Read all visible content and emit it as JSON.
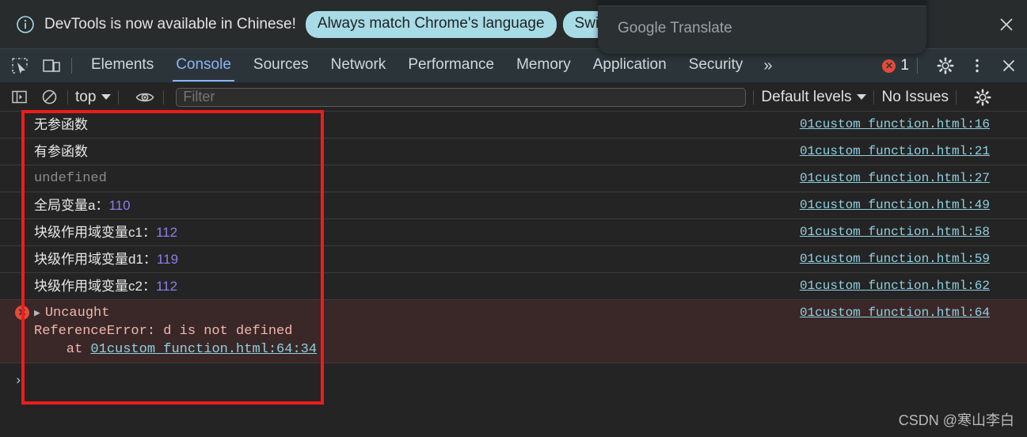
{
  "banner": {
    "info_icon": "info-circle-icon",
    "message": "DevTools is now available in Chinese!",
    "primary_button": "Always match Chrome's language",
    "secondary_button": "Switch D",
    "close_icon": "close-icon"
  },
  "overlay": {
    "popup_title": "Google Translate"
  },
  "tabbar": {
    "inspect_icon": "inspect-element-icon",
    "device_icon": "device-toolbar-icon",
    "tabs": [
      {
        "label": "Elements",
        "active": false
      },
      {
        "label": "Console",
        "active": true
      },
      {
        "label": "Sources",
        "active": false
      },
      {
        "label": "Network",
        "active": false
      },
      {
        "label": "Performance",
        "active": false
      },
      {
        "label": "Memory",
        "active": false
      },
      {
        "label": "Application",
        "active": false
      },
      {
        "label": "Security",
        "active": false
      }
    ],
    "more_tabs": "»",
    "error_badge_glyph": "✕",
    "error_count": "1",
    "settings_icon": "gear-icon",
    "more_icon": "kebab-menu-icon",
    "close_icon": "close-icon"
  },
  "console_toolbar": {
    "sidebar_icon": "console-sidebar-icon",
    "clear_icon": "clear-console-icon",
    "context_selector": "top",
    "eye_icon": "live-expression-icon",
    "filter_placeholder": "Filter",
    "filter_value": "",
    "levels_selector": "Default levels",
    "issues_label": "No Issues",
    "settings_icon": "gear-icon"
  },
  "console_messages": [
    {
      "type": "log",
      "text": "无参函数",
      "value": "",
      "link": "01custom function.html:16"
    },
    {
      "type": "log",
      "text": "有参函数",
      "value": "",
      "link": "01custom function.html:21"
    },
    {
      "type": "undefined",
      "text": "undefined",
      "value": "",
      "link": "01custom function.html:27"
    },
    {
      "type": "log",
      "text": "全局变量a：",
      "value": "110",
      "link": "01custom function.html:49"
    },
    {
      "type": "log",
      "text": "块级作用域变量c1：",
      "value": "112",
      "link": "01custom function.html:58"
    },
    {
      "type": "log",
      "text": "块级作用域变量d1：",
      "value": "119",
      "link": "01custom function.html:59"
    },
    {
      "type": "log",
      "text": "块级作用域变量c2：",
      "value": "112",
      "link": "01custom function.html:62"
    }
  ],
  "console_error": {
    "icon": "error-circle-icon",
    "disclosure": "▶",
    "headline": "Uncaught",
    "body": "ReferenceError: d is not defined",
    "at_prefix": "    at ",
    "at_link": "01custom function.html:64:34",
    "link": "01custom function.html:64"
  },
  "prompt": {
    "caret": "›"
  },
  "annotation": {
    "color": "#ee1c1c"
  },
  "watermark": {
    "text": "CSDN @寒山李白"
  },
  "colors": {
    "accent_blue": "#8ab4f8",
    "banner_button": "#a7dbe6",
    "link": "#8fd0e0",
    "number": "#8d7ee8",
    "error_bg": "#3a2828",
    "error_text": "#f0b6ad",
    "annotation_red": "#ee1c1c"
  }
}
